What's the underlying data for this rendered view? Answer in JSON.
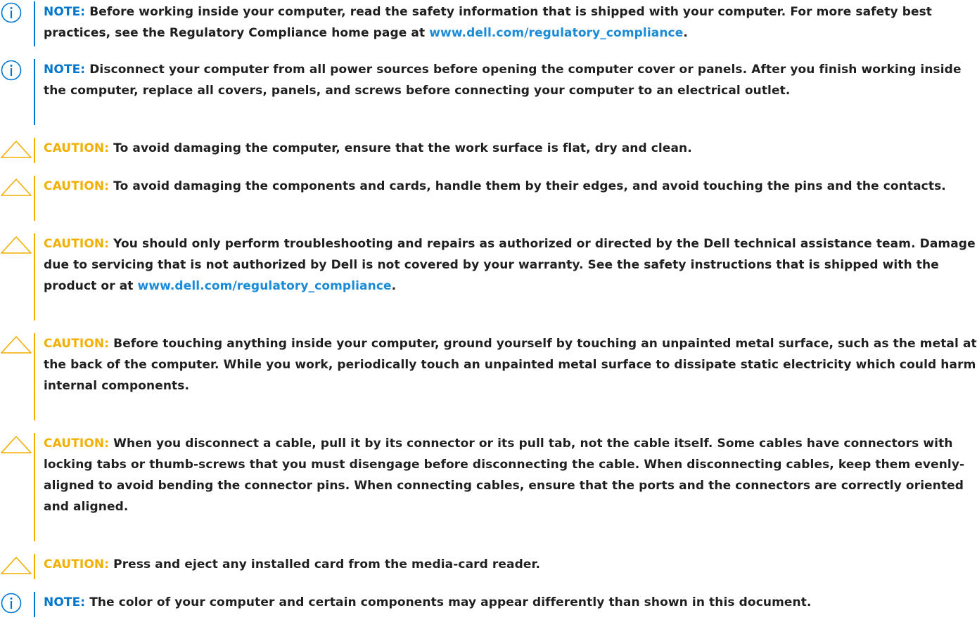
{
  "notices": [
    {
      "type": "note",
      "label": "NOTE:",
      "segments": [
        {
          "text": " Before working inside your computer, read the safety information that is shipped with your computer. For more safety best practices, see the Regulatory Compliance home page at "
        },
        {
          "text": "www.dell.com/regulatory_compliance",
          "link": true
        },
        {
          "text": "."
        }
      ]
    },
    {
      "type": "note",
      "label": "NOTE:",
      "segments": [
        {
          "text": " Disconnect your computer from all power sources before opening the computer cover or panels. After you finish working inside the computer, replace all covers, panels, and screws before connecting your computer to an electrical outlet."
        }
      ]
    },
    {
      "type": "caution",
      "label": "CAUTION:",
      "segments": [
        {
          "text": " To avoid damaging the computer, ensure that the work surface is flat, dry and clean."
        }
      ]
    },
    {
      "type": "caution",
      "label": "CAUTION:",
      "segments": [
        {
          "text": " To avoid damaging the components and cards, handle them by their edges, and avoid touching the pins and the contacts."
        }
      ]
    },
    {
      "type": "caution",
      "label": "CAUTION:",
      "segments": [
        {
          "text": " You should only perform troubleshooting and repairs as authorized or directed by the Dell technical assistance team. Damage due to servicing that is not authorized by Dell is not covered by your warranty. See the safety instructions that is shipped with the product or at "
        },
        {
          "text": "www.dell.com/regulatory_compliance",
          "link": true
        },
        {
          "text": "."
        }
      ]
    },
    {
      "type": "caution",
      "label": "CAUTION:",
      "segments": [
        {
          "text": " Before touching anything inside your computer, ground yourself by touching an unpainted metal surface, such as the metal at the back of the computer. While you work, periodically touch an unpainted metal surface to dissipate static electricity which could harm internal components."
        }
      ]
    },
    {
      "type": "caution",
      "label": "CAUTION:",
      "segments": [
        {
          "text": " When you disconnect a cable, pull it by its connector or its pull tab, not the cable itself. Some cables have connectors with locking tabs or thumb-screws that you must disengage before disconnecting the cable. When disconnecting cables, keep them evenly-aligned to avoid bending the connector pins. When connecting cables, ensure that the ports and the connectors are correctly oriented and aligned."
        }
      ]
    },
    {
      "type": "caution",
      "label": "CAUTION:",
      "segments": [
        {
          "text": " Press and eject any installed card from the media-card reader."
        }
      ]
    },
    {
      "type": "note",
      "label": "NOTE:",
      "segments": [
        {
          "text": " The color of your computer and certain components may appear differently than shown in this document."
        }
      ]
    }
  ],
  "colors": {
    "note": "#0076ce",
    "caution": "#f2af00",
    "link": "#1a8bd6",
    "text": "#1f1f1f"
  }
}
